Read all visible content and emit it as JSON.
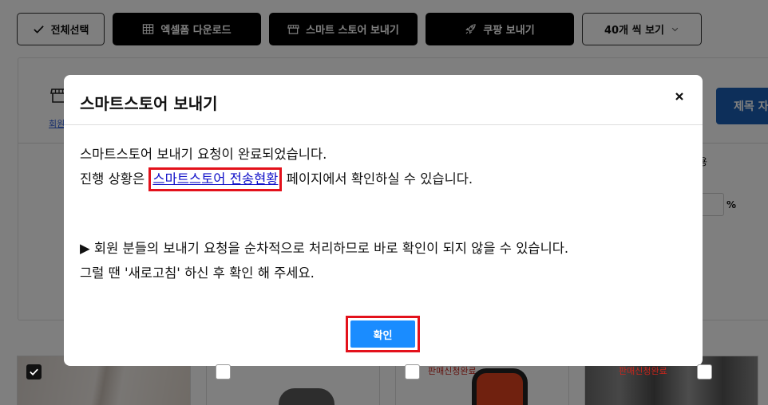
{
  "toolbar": {
    "select_all": "전체선택",
    "excel_download": "엑셀폼 다운로드",
    "smartstore_send": "스마트 스토어 보내기",
    "coupang_send": "쿠팡 보내기",
    "per_page": "40개 씩 보기"
  },
  "panel": {
    "link_fragment": "회원",
    "column_fragment": "용",
    "percent": "%",
    "title_button": "제목 자"
  },
  "cards": [
    {
      "checked": true,
      "tag": ""
    },
    {
      "checked": false,
      "tag": ""
    },
    {
      "checked": false,
      "tag": "판매신청완료"
    },
    {
      "checked": false,
      "tag": "판매신청완료"
    }
  ],
  "modal": {
    "title": "스마트스토어 보내기",
    "close": "×",
    "line1": "스마트스토어 보내기 요청이 완료되었습니다.",
    "line2_before": "진행 상황은 ",
    "line2_link": "스마트스토어 전송현황",
    "line2_after": " 페이지에서 확인하실 수 있습니다.",
    "notice1": "▶ 회원 분들의 보내기 요청을 순차적으로 처리하므로 바로 확인이 되지 않을 수 있습니다.",
    "notice2": "그럴 땐 '새로고침' 하신 후 확인 해 주세요.",
    "confirm": "확인"
  },
  "colors": {
    "highlight_border": "#e3111b",
    "confirm_button": "#1a8cff",
    "link": "#1010c8",
    "title_button": "#1a5fb4"
  }
}
